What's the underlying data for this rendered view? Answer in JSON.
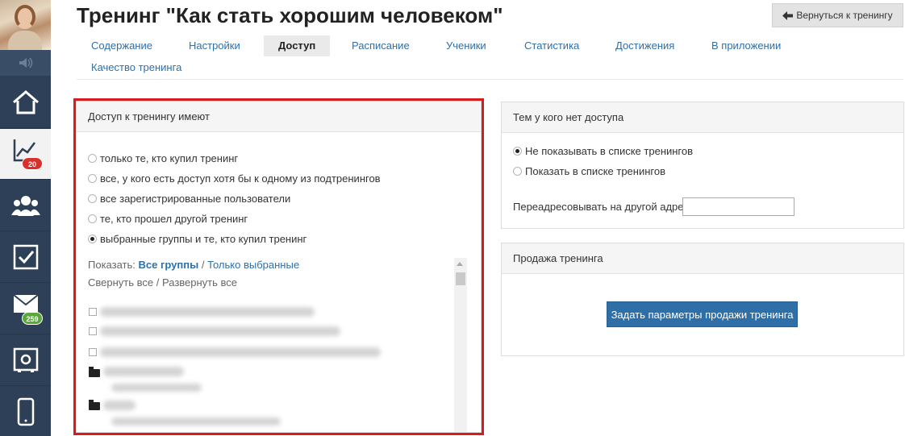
{
  "page": {
    "title": "Тренинг \"Как стать хорошим человеком\"",
    "back_button": "Вернуться к тренингу"
  },
  "sidebar": {
    "badges": {
      "stats": "20",
      "mail": "259"
    },
    "icons": [
      "home-icon",
      "chart-icon",
      "users-icon",
      "checkbox-icon",
      "mail-icon",
      "safe-icon",
      "phone-icon"
    ]
  },
  "tabs": [
    {
      "label": "Содержание"
    },
    {
      "label": "Настройки"
    },
    {
      "label": "Доступ",
      "active": true
    },
    {
      "label": "Расписание"
    },
    {
      "label": "Ученики"
    },
    {
      "label": "Статистика"
    },
    {
      "label": "Достижения"
    },
    {
      "label": "В приложении"
    },
    {
      "label": "Качество тренинга"
    }
  ],
  "access_panel": {
    "title": "Доступ к тренингу имеют",
    "options": [
      {
        "label": "только те, кто купил тренинг",
        "selected": false
      },
      {
        "label": "все, у кого есть доступ хотя бы к одному из подтренингов",
        "selected": false
      },
      {
        "label": "все зарегистрированные пользователи",
        "selected": false
      },
      {
        "label": "те, кто прошел другой тренинг",
        "selected": false
      },
      {
        "label": "выбранные группы и те, кто купил тренинг",
        "selected": true
      }
    ],
    "show_label": "Показать:",
    "all_groups": "Все группы",
    "slash": "/",
    "only_selected": "Только выбранные",
    "collapse_all": "Свернуть все",
    "expand_all": "Развернуть все"
  },
  "no_access_panel": {
    "title": "Тем у кого нет доступа",
    "options": [
      {
        "label": "Не показывать в списке тренингов",
        "selected": true
      },
      {
        "label": "Показать в списке тренингов",
        "selected": false
      }
    ],
    "redirect_label": "Переадресовывать на другой адрес",
    "redirect_value": ""
  },
  "sale_panel": {
    "title": "Продажа тренинга",
    "button": "Задать параметры продажи тренинга"
  },
  "colors": {
    "accent": "#2f6fa8",
    "sidebar": "#2e4057",
    "highlight": "#d41c1c",
    "badge_red": "#d9302a",
    "badge_green": "#5aa83a"
  }
}
